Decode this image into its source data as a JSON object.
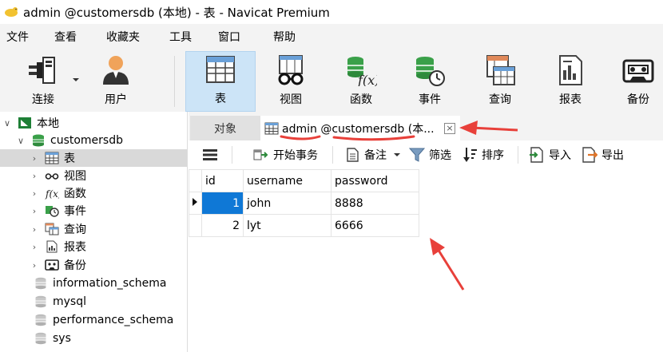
{
  "window": {
    "title": "admin @customersdb (本地) - 表 - Navicat Premium"
  },
  "menu": [
    "文件",
    "查看",
    "收藏夹",
    "工具",
    "窗口",
    "帮助"
  ],
  "toolbar": {
    "connect": "连接",
    "user": "用户",
    "table": "表",
    "view": "视图",
    "function": "函数",
    "event": "事件",
    "query": "查询",
    "report": "报表",
    "backup": "备份"
  },
  "sidebar": {
    "connection": "本地",
    "database": "customersdb",
    "items": [
      "表",
      "视图",
      "函数",
      "事件",
      "查询",
      "报表",
      "备份"
    ],
    "other_databases": [
      "information_schema",
      "mysql",
      "performance_schema",
      "sys"
    ]
  },
  "tabs": {
    "objects": "对象",
    "active": "admin @customersdb (本...",
    "close": "×"
  },
  "subtoolbar": {
    "begin_transaction": "开始事务",
    "note": "备注",
    "filter": "筛选",
    "sort": "排序",
    "import": "导入",
    "export": "导出"
  },
  "grid": {
    "columns": [
      "id",
      "username",
      "password"
    ],
    "rows": [
      [
        "1",
        "john",
        "8888"
      ],
      [
        "2",
        "lyt",
        "6666"
      ]
    ]
  },
  "colors": {
    "accent": "#0f78d6",
    "annotation": "#e8403a",
    "active_tool": "#cce4f7"
  }
}
